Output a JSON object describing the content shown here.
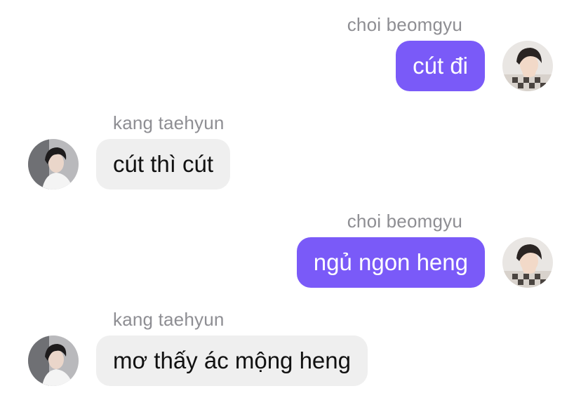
{
  "messages": [
    {
      "direction": "out",
      "sender": "choi beomgyu",
      "text": "cút đi"
    },
    {
      "direction": "in",
      "sender": "kang taehyun",
      "text": "cút thì cút"
    },
    {
      "direction": "out",
      "sender": "choi beomgyu",
      "text": "ngủ ngon heng"
    },
    {
      "direction": "in",
      "sender": "kang taehyun",
      "text": "mơ thấy ác mộng heng"
    }
  ],
  "colors": {
    "outgoing_bubble": "#7A5AF8",
    "incoming_bubble": "#EFEFEF",
    "sender_name": "#8E8E93"
  }
}
